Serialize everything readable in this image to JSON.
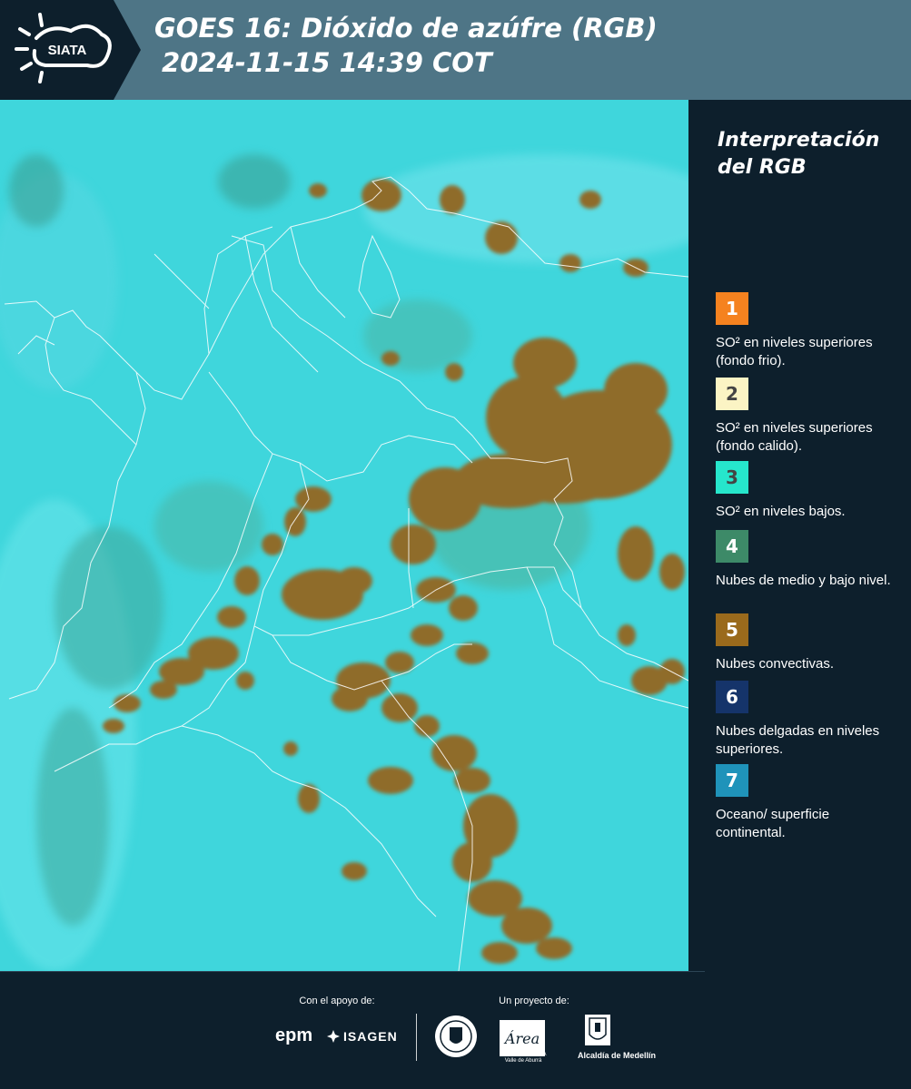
{
  "header": {
    "logo_text": "SIATA",
    "title_line1": "GOES 16: Dióxido de azúfre (RGB)",
    "title_line2": "2024-11-15 14:39 COT",
    "background_color": "#4e7586"
  },
  "legend": {
    "title": "Interpretación del RGB",
    "items": [
      {
        "number": "1",
        "label": "SO² en niveles superiores (fondo frio).",
        "color": "#f5821f",
        "number_color": "#ffffff"
      },
      {
        "number": "2",
        "label": "SO² en niveles superiores (fondo calido).",
        "color": "#fbf4c4",
        "number_color": "#444444"
      },
      {
        "number": "3",
        "label": "SO² en niveles bajos.",
        "color": "#26e6cc",
        "number_color": "#444444"
      },
      {
        "number": "4",
        "label": "Nubes de medio y bajo nivel.",
        "color": "#3d8a68",
        "number_color": "#ffffff"
      },
      {
        "number": "5",
        "label": "Nubes convectivas.",
        "color": "#9a6a1c",
        "number_color": "#ffffff"
      },
      {
        "number": "6",
        "label": "Nubes delgadas en niveles superiores.",
        "color": "#15346a",
        "number_color": "#ffffff"
      },
      {
        "number": "7",
        "label": "Oceano/ superficie continental.",
        "color": "#1f93ba",
        "number_color": "#ffffff"
      }
    ]
  },
  "map": {
    "background_color": "#3fd6dc",
    "cloud_color": "#8f6c2c",
    "border_color": "#ffffff"
  },
  "footer": {
    "support_label": "Con el apoyo de:",
    "project_label": "Un proyecto de:",
    "sponsor_1": "epm",
    "sponsor_2": "ISAGEN",
    "amva_name": "Área",
    "amva_subtitle": "METROPOLITANA Valle de Aburrá",
    "alcaldia": "Alcaldía de Medellín"
  }
}
